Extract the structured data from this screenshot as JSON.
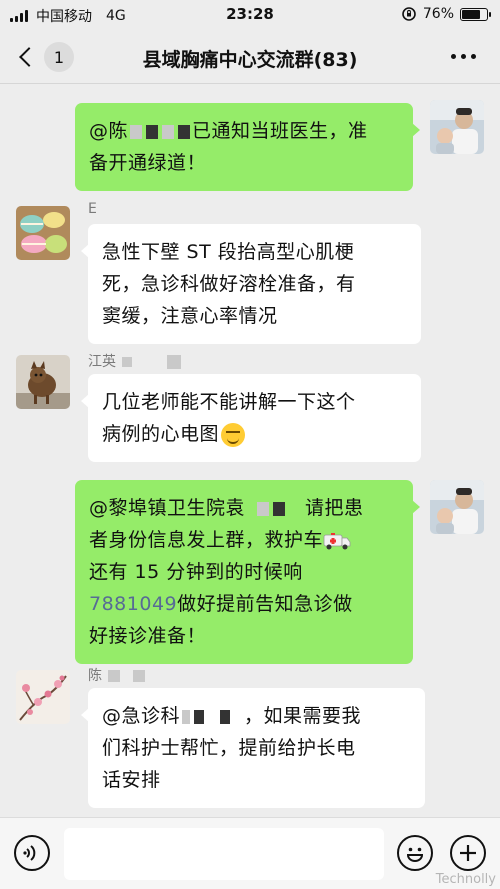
{
  "status_bar": {
    "carrier": "中国移动",
    "network": "4G",
    "time": "23:28",
    "battery": "76%",
    "battery_level": 0.76
  },
  "nav": {
    "unread_count": "1",
    "title": "县域胸痛中心交流群(83)"
  },
  "messages": [
    {
      "side": "mine",
      "parts": {
        "p1": "@陈",
        "p2": "已通知当班医生，准",
        "line2": "备开通绿道！"
      }
    },
    {
      "side": "theirs",
      "sender": "E",
      "lines": [
        "急性下壁 ST 段抬高型心肌梗",
        "死，急诊科做好溶栓准备，有",
        "窦缓，注意心率情况"
      ]
    },
    {
      "side": "theirs",
      "sender": "江英",
      "lines": [
        "几位老师能不能讲解一下这个",
        "病例的心电图"
      ]
    },
    {
      "side": "mine",
      "parts": {
        "l1a": "@黎埠镇卫生院袁",
        "l1b": "请把患",
        "l2": "者身份信息发上群，救护车",
        "l3": "还有 15 分钟到的时候响",
        "l4_num": "7881049",
        "l4_rest": "做好提前告知急诊做",
        "l5": "好接诊准备！"
      }
    },
    {
      "side": "theirs",
      "sender": "陈",
      "parts": {
        "l1a": "@急诊科",
        "l1b": "，如果需要我",
        "l2": "们科护士帮忙，提前给护长电",
        "l3": "话安排"
      }
    }
  ],
  "input_bar": {
    "placeholder": "",
    "value": ""
  },
  "watermark": "Technolly",
  "colors": {
    "mine_bubble": "#95ec69",
    "theirs_bubble": "#ffffff",
    "background": "#ededed",
    "link": "#576b95"
  }
}
